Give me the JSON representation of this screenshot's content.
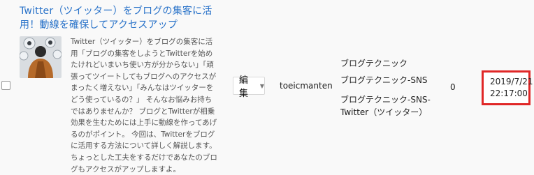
{
  "post": {
    "title": "Twitter（ツイッター）をブログの集客に活用！動線を確保してアクセスアップ",
    "excerpt": "Twitter（ツイッター）をブログの集客に活用「ブログの集客をしようとTwitterを始めたけれどいまいち使い方が分からない」「頑張ってツイートしてもブログへのアクセスがまったく増えない」「みんなはツイッターをどう使っているの？」 そんなお悩みお持ちではありませんか？ ブログとTwitterが相乗効果を生むためには上手に動線を作ってあげるのがポイント。 今回は、Twitterをブログに活用する方法について詳しく解説します。 ちょっとした工夫をするだけであなたのブログもアクセスがアップしますよ。",
    "edit_label": "編集",
    "author": "toeicmanten",
    "categories": [
      "ブログテクニック",
      "ブログテクニック-SNS",
      "ブログテクニック-SNS-Twitter（ツイッター）"
    ],
    "count": "0",
    "date_line1": "2019/7/21",
    "date_line2": "22:17:00"
  },
  "colors": {
    "title": "#2a73c9",
    "highlight_border": "#e02727"
  }
}
